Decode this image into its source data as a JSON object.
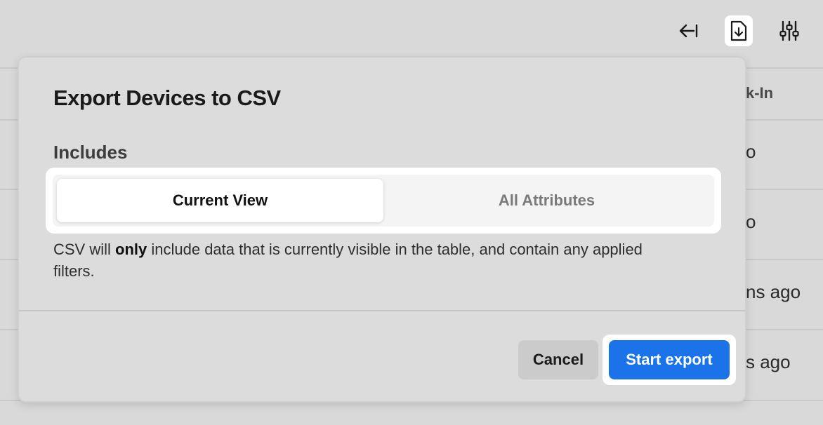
{
  "background_table": {
    "header_partial": "k-In",
    "rows_partial": [
      "o",
      "o",
      "ns ago",
      "s ago"
    ]
  },
  "toolbar": {
    "icons": [
      "collapse-left-icon",
      "export-file-icon",
      "filter-sliders-icon"
    ]
  },
  "modal": {
    "title": "Export Devices to CSV",
    "section_label": "Includes",
    "segments": {
      "current_view": "Current View",
      "all_attributes": "All Attributes",
      "selected": "Current View"
    },
    "description_pre": "CSV will ",
    "description_bold": "only",
    "description_post": " include data that is currently visible in the table, and contain any applied filters.",
    "cancel_label": "Cancel",
    "start_label": "Start export"
  },
  "colors": {
    "primary": "#1a73e8",
    "overlay_bg": "#d9d9d9"
  }
}
